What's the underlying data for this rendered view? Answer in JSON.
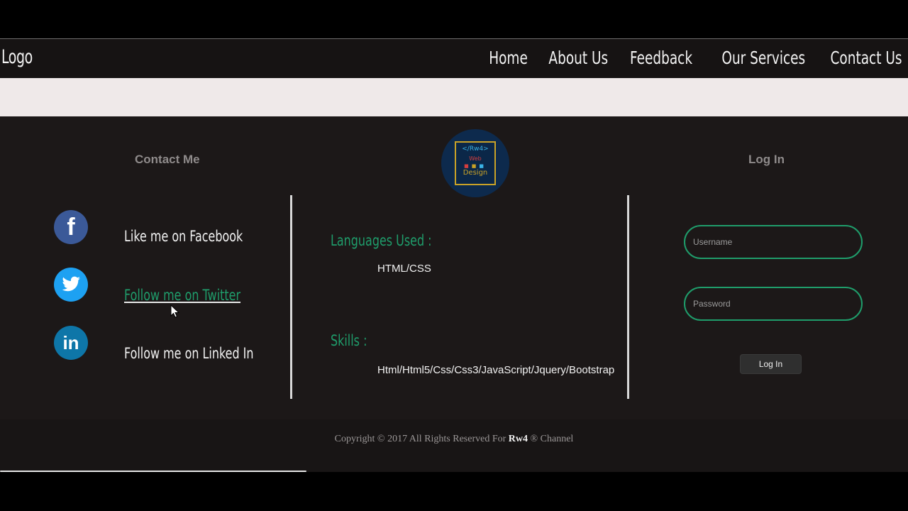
{
  "header": {
    "logo": "Logo",
    "nav": [
      "Home",
      "About Us",
      "Feedback",
      "Our Services",
      "Contact Us"
    ]
  },
  "footer": {
    "contact": {
      "title": "Contact Me",
      "links": [
        "Like me on Facebook",
        "Follow me on Twitter",
        "Follow me on Linked In"
      ]
    },
    "brand": {
      "line1": "</Rw4>",
      "line2": "Web",
      "line3": "Design"
    },
    "middle": {
      "languages_label": "Languages Used :",
      "languages_value": "HTML/CSS",
      "skills_label": "Skills :",
      "skills_value": "Html/Html5/Css/Css3/JavaScript/Jquery/Bootstrap"
    },
    "login": {
      "title": "Log In",
      "username_placeholder": "Username",
      "password_placeholder": "Password",
      "button": "Log In"
    },
    "copyright": {
      "prefix": "Copyright © 2017 All Rights Reserved For",
      "brand": "Rw4",
      "suffix": "® Channel"
    }
  },
  "colors": {
    "accent": "#1f9d6b",
    "footer_bg": "#1c1818",
    "nav_bg": "#161313"
  },
  "icons": [
    "facebook-icon",
    "twitter-icon",
    "linkedin-icon",
    "mouse-cursor-icon"
  ]
}
